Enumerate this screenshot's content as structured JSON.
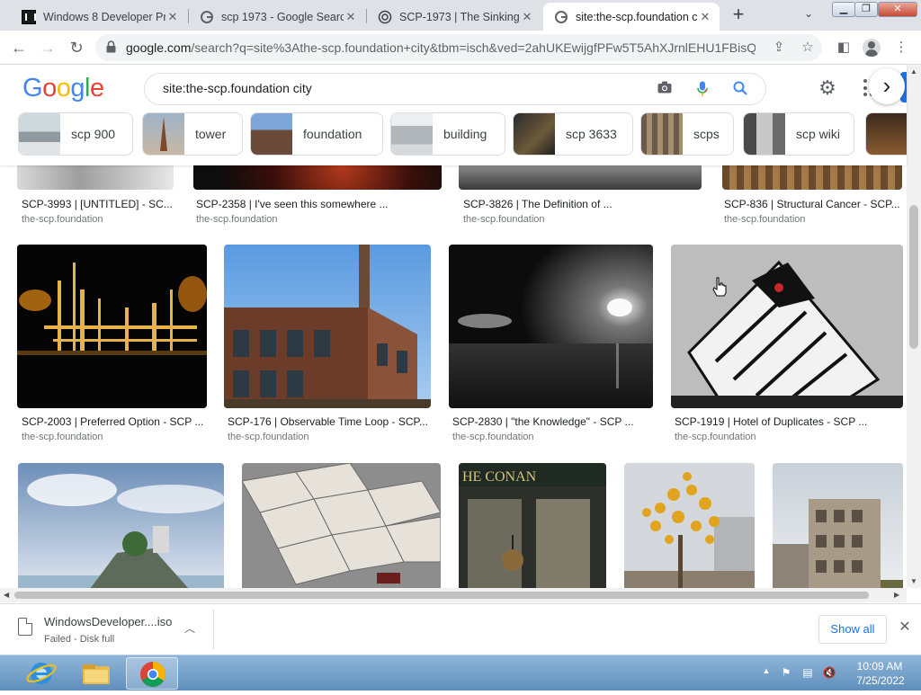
{
  "tabs": [
    {
      "title": "Windows 8 Developer Pr",
      "favicon": "windows-icon",
      "active": false
    },
    {
      "title": "scp 1973 - Google Search",
      "favicon": "google-icon",
      "active": false
    },
    {
      "title": "SCP-1973 | The Sinking F",
      "favicon": "scp-logo-icon",
      "active": false
    },
    {
      "title": "site:the-scp.foundation c",
      "favicon": "google-icon",
      "active": true
    }
  ],
  "toolbar": {
    "url_host": "google.com",
    "url_path": "/search?q=site%3Athe-scp.foundation+city&tbm=isch&ved=2ahUKEwijgfPFw5T5AhXJrnlEHU1FBisQ..."
  },
  "google": {
    "logo": "Google",
    "search_query": "site:the-scp.foundation city",
    "chips": [
      {
        "label": "scp 900"
      },
      {
        "label": "tower"
      },
      {
        "label": "foundation"
      },
      {
        "label": "building"
      },
      {
        "label": "scp 3633"
      },
      {
        "label": "scps"
      },
      {
        "label": "scp wiki"
      }
    ]
  },
  "results": {
    "row1": [
      {
        "title": "SCP-3993 | [UNTITLED] - SC...",
        "source": "the-scp.foundation"
      },
      {
        "title": "SCP-2358 | I've seen this somewhere ...",
        "source": "the-scp.foundation"
      },
      {
        "title": "SCP-3826 | The Definition of ...",
        "source": "the-scp.foundation"
      },
      {
        "title": "SCP-836 | Structural Cancer - SCP...",
        "source": "the-scp.foundation"
      }
    ],
    "row2": [
      {
        "title": "SCP-2003 | Preferred Option - SCP ...",
        "source": "the-scp.foundation"
      },
      {
        "title": "SCP-176 | Observable Time Loop - SCP...",
        "source": "the-scp.foundation"
      },
      {
        "title": "SCP-2830 | \"the Knowledge\" - SCP ...",
        "source": "the-scp.foundation"
      },
      {
        "title": "SCP-1919 | Hotel of Duplicates - SCP ...",
        "source": "the-scp.foundation"
      }
    ]
  },
  "downloads": {
    "filename": "WindowsDeveloper....iso",
    "status": "Failed - Disk full",
    "show_all": "Show all"
  },
  "taskbar": {
    "time": "10:09 AM",
    "date": "7/25/2022"
  },
  "colors": {
    "google_blue": "#4285F4",
    "google_red": "#EA4335",
    "google_yellow": "#FBBC05",
    "google_green": "#34A853",
    "link_blue": "#1a73e8"
  }
}
